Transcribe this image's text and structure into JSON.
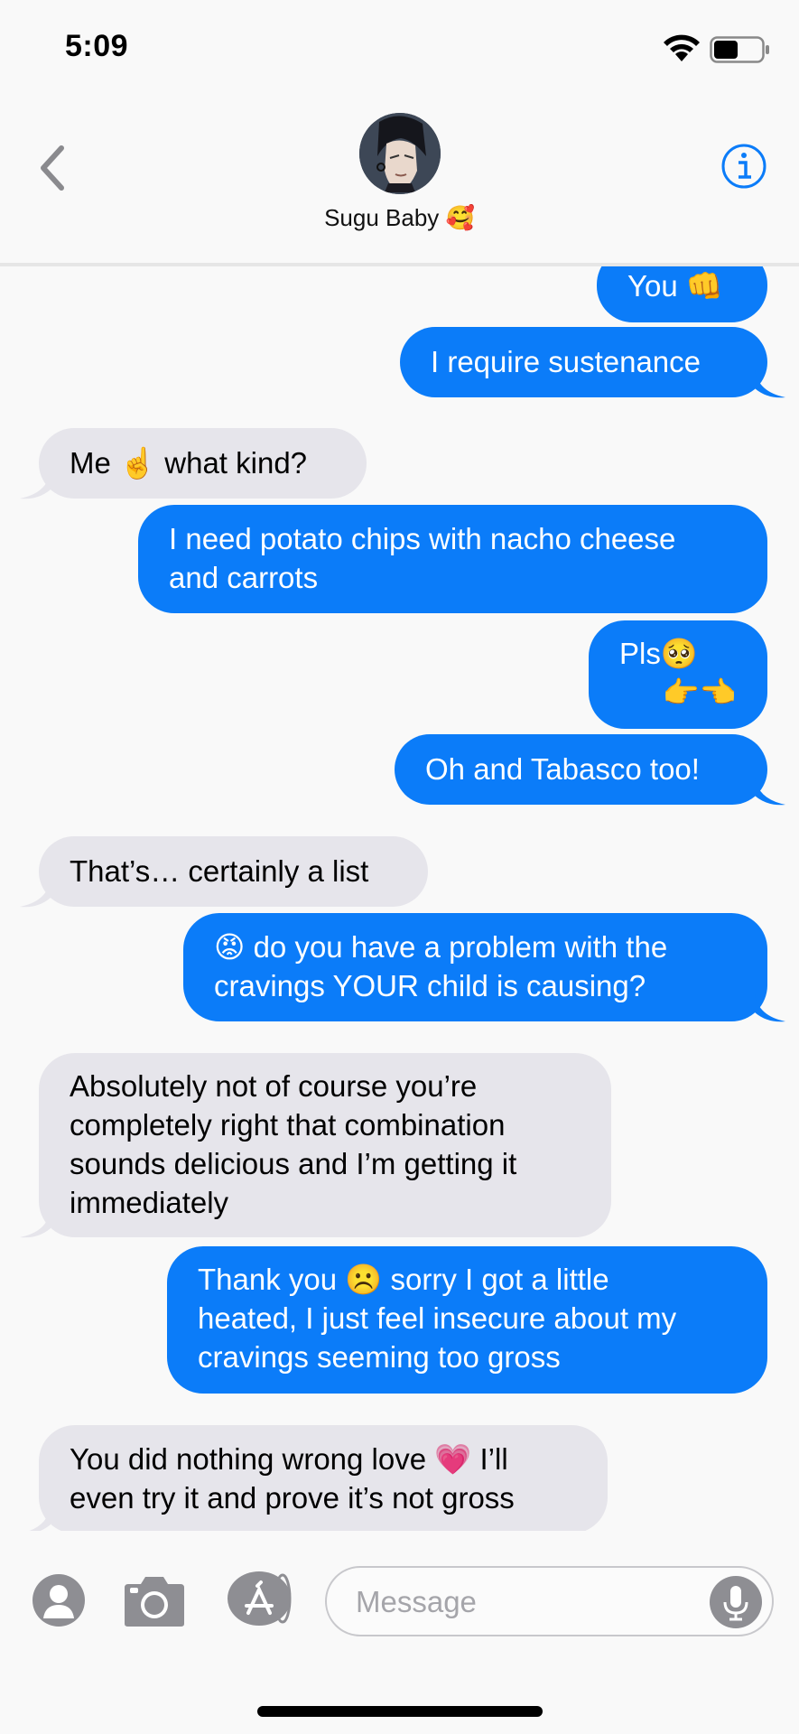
{
  "status_bar": {
    "time": "5:09"
  },
  "header": {
    "contact_name": "Sugu Baby 🥰"
  },
  "messages": [
    {
      "dir": "out",
      "text": "You 👊"
    },
    {
      "dir": "out",
      "text": "I require sustenance"
    },
    {
      "dir": "in",
      "text": "Me ☝️ what kind?"
    },
    {
      "dir": "out",
      "lines": [
        "I need potato chips with nacho cheese",
        "and carrots"
      ]
    },
    {
      "dir": "out",
      "lines": [
        "Pls🥺",
        "👉👈"
      ]
    },
    {
      "dir": "out",
      "text": "Oh and Tabasco too!"
    },
    {
      "dir": "in",
      "text": "That’s… certainly a list"
    },
    {
      "dir": "out",
      "lines": [
        "😡 do you have a problem with the",
        "cravings YOUR child is causing?"
      ]
    },
    {
      "dir": "in",
      "lines": [
        "Absolutely not of course you’re",
        "completely right that combination",
        "sounds delicious and I’m getting it",
        "immediately"
      ]
    },
    {
      "dir": "out",
      "lines": [
        "Thank you ☹️ sorry I got a little",
        "heated, I just feel insecure about my",
        "cravings seeming too gross"
      ]
    },
    {
      "dir": "in",
      "lines": [
        "You did nothing wrong love 💗 I’ll",
        "even try it and prove it’s not gross"
      ]
    }
  ],
  "composer": {
    "placeholder": "Message"
  },
  "icons": {
    "back": "chevron-left-icon",
    "info": "info-icon",
    "contacts": "person-icon",
    "camera": "camera-icon",
    "apps": "app-store-icon",
    "mic": "microphone-icon"
  },
  "colors": {
    "outgoing": "#0b7cf9",
    "incoming": "#e6e5eb",
    "accent": "#0b7cf9"
  }
}
